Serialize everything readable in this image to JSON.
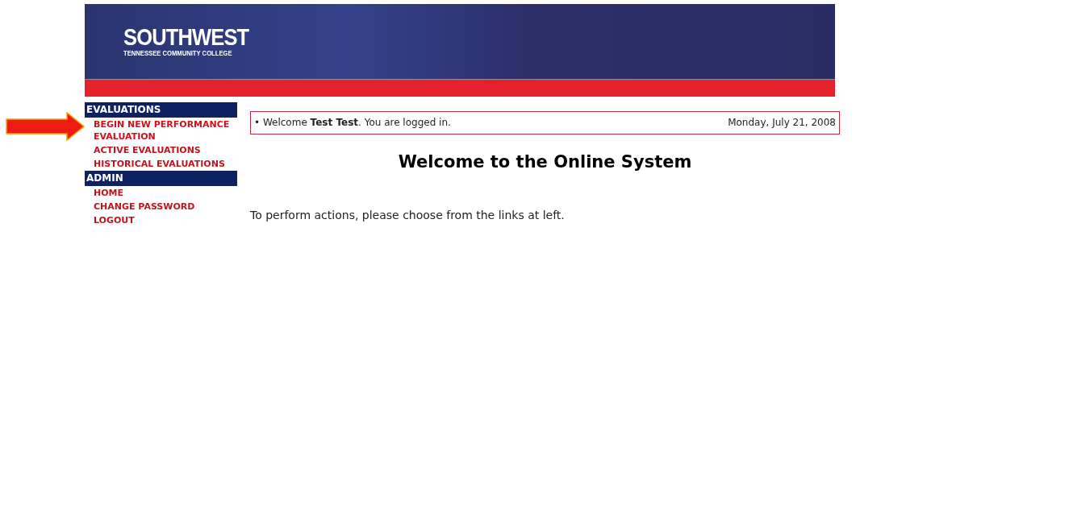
{
  "header": {
    "logo_title": "SOUTHWEST",
    "logo_subtitle": "TENNESSEE COMMUNITY COLLEGE"
  },
  "sidebar": {
    "sections": [
      {
        "title": "EVALUATIONS",
        "items": [
          {
            "label": "BEGIN NEW PERFORMANCE EVALUATION",
            "highlighted": true
          },
          {
            "label": "ACTIVE EVALUATIONS",
            "highlighted": false
          },
          {
            "label": "HISTORICAL EVALUATIONS",
            "highlighted": false
          }
        ]
      },
      {
        "title": "ADMIN",
        "items": [
          {
            "label": "HOME",
            "highlighted": false
          },
          {
            "label": "CHANGE PASSWORD",
            "highlighted": false
          },
          {
            "label": "LOGOUT",
            "highlighted": false
          }
        ]
      }
    ]
  },
  "status_bar": {
    "welcome": "• Welcome **Test Test**. You are logged in.",
    "date": "Monday, July 21, 2008"
  },
  "heading": "Welcome to the Online System",
  "body": "To perform actions, please choose from the links at left."
}
